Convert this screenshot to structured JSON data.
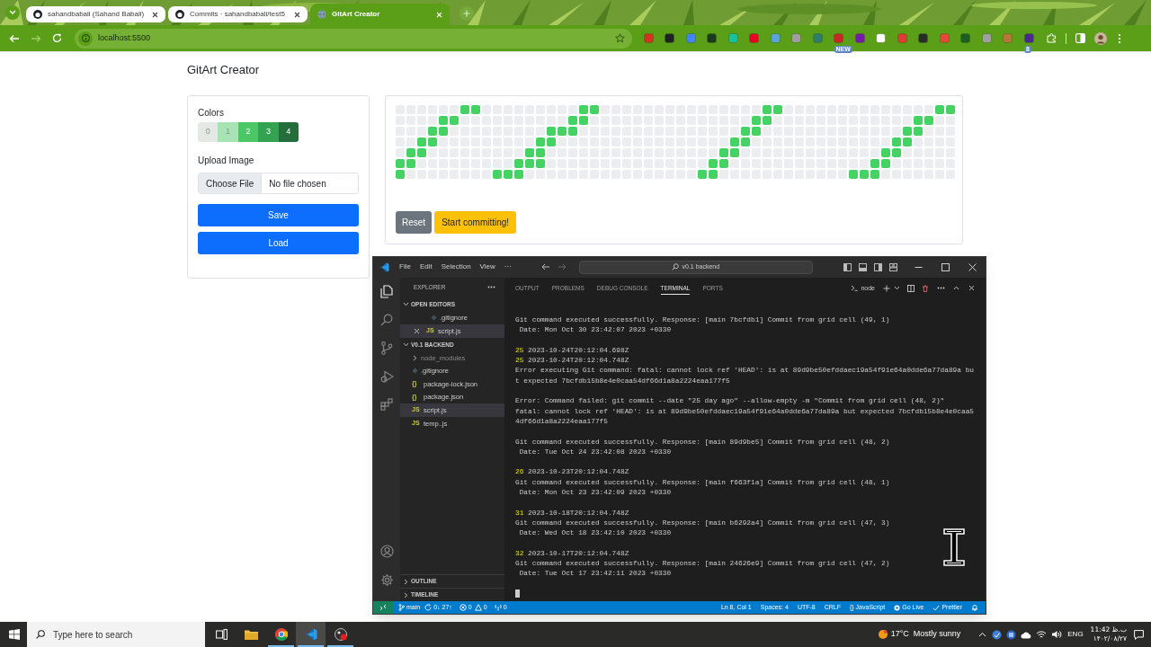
{
  "browser": {
    "tabs": [
      {
        "title": "sahandbabali (Sahand Babali)",
        "selected": false,
        "kind": "github"
      },
      {
        "title": "Commits · sahandbabali/test5",
        "selected": false,
        "kind": "github"
      },
      {
        "title": "GitArt Creator",
        "selected": true,
        "kind": "globe"
      }
    ],
    "address": "localhost:5500",
    "extensions": [
      {
        "color": "#d93025"
      },
      {
        "color": "#202124"
      },
      {
        "color": "#4285f4"
      },
      {
        "color": "#1e3a1e"
      },
      {
        "color": "#15c39a"
      },
      {
        "color": "#e60023"
      },
      {
        "color": "#5ba4d6"
      },
      {
        "color": "#9e9e9e"
      },
      {
        "color": "#2e7d6a"
      },
      {
        "color": "#c62828",
        "badge": "NEW"
      },
      {
        "color": "#7719aa"
      },
      {
        "color": "#ffffff"
      },
      {
        "color": "#e53935"
      },
      {
        "color": "#2b2b2b"
      },
      {
        "color": "#e8453c"
      },
      {
        "color": "#1b5e20"
      },
      {
        "color": "#a0a0a0"
      },
      {
        "color": "#b8773a"
      },
      {
        "color": "#4a2a8a",
        "badge": "8"
      }
    ]
  },
  "page": {
    "title": "GitArt Creator",
    "colors_label": "Colors",
    "swatches": [
      {
        "label": "0",
        "color": "#e4e9e6"
      },
      {
        "label": "1",
        "color": "#a6e5b3"
      },
      {
        "label": "2",
        "color": "#4cc766"
      },
      {
        "label": "3",
        "color": "#33a352"
      },
      {
        "label": "4",
        "color": "#236e3b"
      }
    ],
    "upload_label": "Upload Image",
    "file_button": "Choose File",
    "file_status": "No file chosen",
    "buttons": [
      "Save",
      "Load"
    ],
    "grid": [
      [
        false,
        false,
        false,
        false,
        false,
        false,
        true,
        true,
        false,
        false,
        false,
        false,
        false,
        false,
        false,
        false,
        false,
        true,
        true,
        false,
        false,
        false,
        false,
        false,
        false,
        false,
        false,
        false,
        false,
        false,
        false,
        false,
        false,
        false,
        true,
        true,
        false,
        false,
        false,
        false,
        false,
        false,
        false,
        false,
        false,
        false,
        false,
        false,
        false,
        false,
        true,
        true
      ],
      [
        false,
        false,
        false,
        false,
        true,
        true,
        false,
        false,
        false,
        false,
        false,
        false,
        false,
        false,
        false,
        false,
        true,
        true,
        false,
        false,
        false,
        false,
        false,
        false,
        false,
        false,
        false,
        false,
        false,
        false,
        false,
        false,
        false,
        true,
        true,
        false,
        false,
        false,
        false,
        false,
        false,
        false,
        false,
        false,
        false,
        false,
        false,
        false,
        true,
        true,
        false,
        false
      ],
      [
        false,
        false,
        false,
        true,
        true,
        false,
        false,
        false,
        false,
        false,
        false,
        false,
        false,
        false,
        true,
        true,
        true,
        false,
        false,
        false,
        false,
        false,
        false,
        false,
        false,
        false,
        false,
        false,
        false,
        false,
        false,
        false,
        true,
        true,
        false,
        false,
        false,
        false,
        false,
        false,
        false,
        false,
        false,
        false,
        false,
        false,
        false,
        true,
        true,
        false,
        false,
        false
      ],
      [
        false,
        false,
        true,
        true,
        false,
        false,
        false,
        false,
        false,
        false,
        false,
        false,
        false,
        true,
        true,
        false,
        false,
        false,
        false,
        false,
        false,
        false,
        false,
        false,
        false,
        false,
        false,
        false,
        false,
        false,
        false,
        true,
        true,
        false,
        false,
        false,
        false,
        false,
        false,
        false,
        false,
        false,
        false,
        false,
        false,
        false,
        true,
        true,
        false,
        false,
        false,
        false
      ],
      [
        false,
        true,
        true,
        false,
        false,
        false,
        false,
        false,
        false,
        false,
        false,
        false,
        true,
        true,
        false,
        false,
        false,
        false,
        false,
        false,
        false,
        false,
        false,
        false,
        false,
        false,
        false,
        false,
        false,
        false,
        true,
        true,
        false,
        false,
        false,
        false,
        false,
        false,
        false,
        false,
        false,
        false,
        false,
        false,
        false,
        true,
        true,
        false,
        false,
        false,
        false,
        false
      ],
      [
        true,
        true,
        false,
        false,
        false,
        false,
        false,
        false,
        false,
        false,
        false,
        true,
        true,
        true,
        false,
        false,
        false,
        false,
        false,
        false,
        false,
        false,
        false,
        false,
        false,
        false,
        false,
        false,
        false,
        true,
        true,
        false,
        false,
        false,
        false,
        false,
        false,
        false,
        false,
        false,
        false,
        false,
        false,
        false,
        true,
        true,
        false,
        false,
        false,
        false,
        false,
        false
      ],
      [
        true,
        false,
        false,
        false,
        false,
        false,
        false,
        false,
        false,
        true,
        true,
        true,
        false,
        false,
        false,
        false,
        false,
        false,
        false,
        false,
        false,
        false,
        false,
        false,
        false,
        false,
        false,
        false,
        true,
        true,
        false,
        false,
        false,
        false,
        false,
        false,
        false,
        false,
        false,
        false,
        false,
        false,
        true,
        true,
        true,
        false,
        false,
        false,
        false,
        false,
        false,
        false
      ]
    ],
    "actions": [
      {
        "label": "Reset",
        "kind": "secondary"
      },
      {
        "label": "Start committing!",
        "kind": "warning"
      }
    ]
  },
  "vscode": {
    "menu": [
      "File",
      "Edit",
      "Selection",
      "View",
      "···"
    ],
    "search": "v0.1 backend",
    "sidebar_title": "EXPLORER",
    "open_editors": {
      "title": "OPEN EDITORS",
      "expanded": true,
      "items": [
        {
          "name": ".gitignore",
          "kind": "git",
          "active": false
        },
        {
          "name": "script.js",
          "kind": "js",
          "icon": "JS",
          "active": true
        }
      ]
    },
    "project": {
      "title": "V0.1 BACKEND",
      "expanded": true,
      "items": [
        {
          "name": "node_modules",
          "kind": "folder",
          "selected": false
        },
        {
          "name": ".gitignore",
          "kind": "git",
          "selected": false
        },
        {
          "name": "package-lock.json",
          "kind": "json",
          "icon": "{}",
          "selected": false
        },
        {
          "name": "package.json",
          "kind": "json",
          "icon": "{}",
          "selected": false
        },
        {
          "name": "script.js",
          "kind": "js",
          "icon": "JS",
          "selected": true
        },
        {
          "name": "temp..js",
          "kind": "js",
          "icon": "JS",
          "selected": false
        }
      ]
    },
    "bottom_sections": [
      {
        "title": "OUTLINE",
        "expanded": false
      },
      {
        "title": "TIMELINE",
        "expanded": false
      }
    ],
    "panel_tabs": [
      {
        "label": "OUTPUT",
        "selected": false
      },
      {
        "label": "PROBLEMS",
        "selected": false
      },
      {
        "label": "DEBUG CONSOLE",
        "selected": false
      },
      {
        "label": "TERMINAL",
        "selected": true
      },
      {
        "label": "PORTS",
        "selected": false
      }
    ],
    "terminal_name": "node",
    "terminal": [
      {
        "lines": [
          {
            "text": "Git command executed successfully. Response: [main 7bcfdb1] Commit from grid cell (49, 1)"
          },
          {
            "text": " Date: Mon Oct 30 23:42:07 2023 +0330"
          }
        ]
      },
      {
        "lines": [
          {
            "number": "25",
            "text": "2023-10-24T20:12:04.698Z"
          },
          {
            "number": "25",
            "text": "2023-10-24T20:12:04.748Z"
          },
          {
            "text": "Error executing Git command: fatal: cannot lock ref 'HEAD': is at 89d9be50efddaec19a54f91e64a0dde6a77da89a bu"
          },
          {
            "text": "t expected 7bcfdb15b8e4e0caa54df66d1a8a2224eaa177f5"
          }
        ]
      },
      {
        "lines": [
          {
            "text": "Error: Command failed: git commit --date \"25 day ago\" --allow-empty -m \"Commit from grid cell (48, 2)\""
          },
          {
            "text": "fatal: cannot lock ref 'HEAD': is at 89d9be50efddaec19a54f91e64a0dde6a77da89a but expected 7bcfdb15b8e4e0caa5"
          },
          {
            "text": "4df66d1a8a2224eaa177f5"
          }
        ]
      },
      {
        "lines": [
          {
            "text": "Git command executed successfully. Response: [main 89d9be5] Commit from grid cell (48, 2)"
          },
          {
            "text": " Date: Tue Oct 24 23:42:08 2023 +0330"
          }
        ]
      },
      {
        "lines": [
          {
            "number": "26",
            "text": "2023-10-23T20:12:04.748Z"
          },
          {
            "text": "Git command executed successfully. Response: [main f663f1a] Commit from grid cell (48, 1)"
          },
          {
            "text": " Date: Mon Oct 23 23:42:09 2023 +0330"
          }
        ]
      },
      {
        "lines": [
          {
            "number": "31",
            "text": "2023-10-18T20:12:04.748Z"
          },
          {
            "text": "Git command executed successfully. Response: [main b6292a4] Commit from grid cell (47, 3)"
          },
          {
            "text": " Date: Wed Oct 18 23:42:10 2023 +0330"
          }
        ]
      },
      {
        "lines": [
          {
            "number": "32",
            "text": "2023-10-17T20:12:04.748Z"
          },
          {
            "text": "Git command executed successfully. Response: [main 24626e9] Commit from grid cell (47, 2)"
          },
          {
            "text": " Date: Tue Oct 17 23:42:11 2023 +0330"
          }
        ]
      }
    ],
    "status": {
      "branch": "main",
      "sync": "0↓ 27↑",
      "errors": "0",
      "warnings": "0",
      "ports": "0",
      "right": [
        {
          "text": "Ln 8, Col 1",
          "kind": "plain"
        },
        {
          "text": "Spaces: 4",
          "kind": "plain"
        },
        {
          "text": "UTF-8",
          "kind": "plain"
        },
        {
          "text": "CRLF",
          "kind": "plain"
        },
        {
          "text": "{} JavaScript",
          "kind": "plain"
        },
        {
          "text": "Go Live",
          "kind": "live"
        },
        {
          "text": "Prettier",
          "kind": "check"
        }
      ]
    }
  },
  "taskbar": {
    "search_placeholder": "Type here to search",
    "apps": [
      {
        "kind": "taskview",
        "running": false,
        "active": false
      },
      {
        "kind": "explorer",
        "running": false,
        "active": false
      },
      {
        "kind": "chrome",
        "running": true,
        "active": false
      },
      {
        "kind": "vscode",
        "running": true,
        "active": true
      },
      {
        "kind": "obs",
        "running": true,
        "active": false
      }
    ],
    "temperature": "17°C",
    "weather": "Mostly sunny",
    "language": "ENG",
    "time": "11:42 ب.ظ",
    "date": "۱۴۰۲/۰۸/۲۷"
  }
}
